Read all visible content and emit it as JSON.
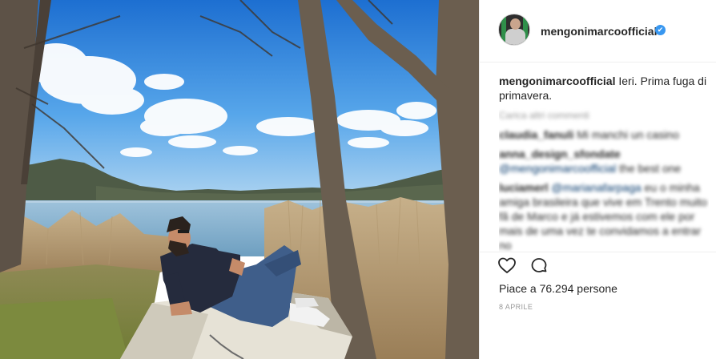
{
  "post": {
    "username": "mengonimarcoofficial",
    "verified_mark": "✔",
    "caption_text": "Ieri. Prima fuga di primavera.",
    "load_more": "Carica altri commenti",
    "comments": [
      {
        "user": "claudia_fanuli",
        "text": "Mi manchi un casino"
      },
      {
        "user": "anna_design_sfondate",
        "mention": "@mengonimarcoofficial",
        "text": "the best one"
      },
      {
        "user": "luciamerl",
        "mention": "@marianafarpaga",
        "text": "eu o minha amiga brasileira que vive em Trento muito fã de Marco e já estivemos com ele por mais de uma vez te convidamos a entrar no"
      }
    ],
    "likes": "Piace a 76.294 persone",
    "date": "8 APRILE",
    "icons": {
      "like": "heart-icon",
      "comment": "comment-icon"
    },
    "colors": {
      "verified": "#3897f0",
      "border": "#efefef",
      "muted": "#999999"
    }
  }
}
